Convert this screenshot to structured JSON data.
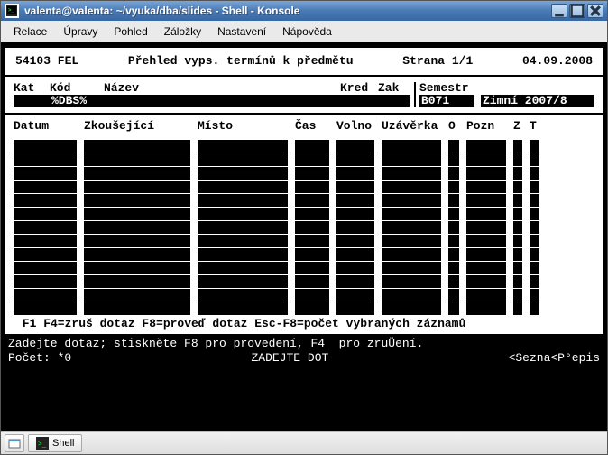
{
  "titlebar": {
    "title": "valenta@valenta: ~/vyuka/dba/slides - Shell - Konsole"
  },
  "menubar": {
    "items": [
      "Relace",
      "Úpravy",
      "Pohled",
      "Záložky",
      "Nastavení",
      "Nápověda"
    ]
  },
  "header": {
    "code": "54103 FEL",
    "title": "Přehled vyps. termínů k předmětu",
    "page": "Strana 1/1",
    "date": "04.09.2008"
  },
  "fields": {
    "kat_label": "Kat",
    "kat_val": "   ",
    "kod_label": "Kód",
    "kod_val": "%DBS%",
    "nazev_label": "Název",
    "nazev_val": "                         ",
    "kred_label": "Kred",
    "kred_val": "   ",
    "zak_label": "Zak",
    "zak_val": "   ",
    "sem_label": "Semestr",
    "sem_val1": "B071",
    "sem_val2": "Zimní 2007/8"
  },
  "columns": {
    "datum": "Datum",
    "zkousejici": "Zkoušející",
    "misto": "Místo",
    "cas": "Čas",
    "volno": "Volno",
    "uzaverka": "Uzávěrka",
    "o": "O",
    "pozn": "Pozn",
    "z": "Z",
    "t": "T"
  },
  "rows_count": 13,
  "hint": " F1 F4=zruš dotaz F8=proveď dotaz Esc-F8=počet vybraných záznamů",
  "status": {
    "line1": "Zadejte dotaz; stiskněte F8 pro provedení, F4  pro zruÜení.",
    "count": "Počet: *0",
    "mode": "ZADEJTE DOT",
    "right": "<Sezna<P°epis"
  },
  "taskbar": {
    "shell": "Shell"
  }
}
